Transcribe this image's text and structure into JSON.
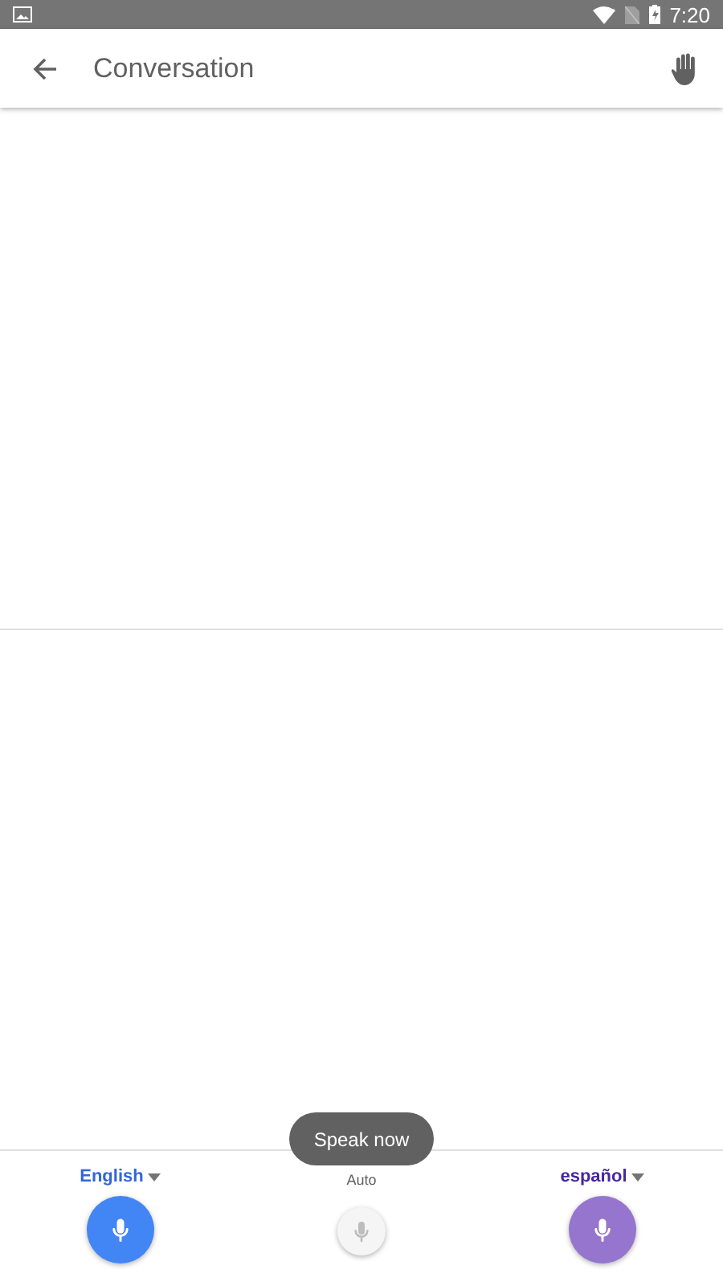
{
  "status_bar": {
    "time": "7:20"
  },
  "app_bar": {
    "title": "Conversation"
  },
  "toast": {
    "text": "Speak now"
  },
  "languages": [
    {
      "kind": "language",
      "label": "English",
      "color": "#4285f4"
    },
    {
      "kind": "auto",
      "label": "Auto"
    },
    {
      "kind": "language",
      "label": "español",
      "color": "#9575cd"
    }
  ]
}
